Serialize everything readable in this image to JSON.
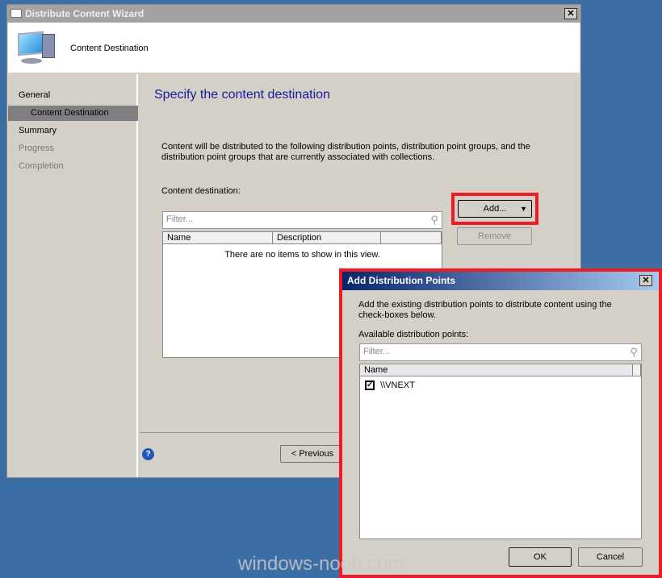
{
  "wizard": {
    "title": "Distribute Content Wizard",
    "header": "Content Destination",
    "nav": [
      {
        "label": "General",
        "state": "normal"
      },
      {
        "label": "Content Destination",
        "state": "selected"
      },
      {
        "label": "Summary",
        "state": "normal"
      },
      {
        "label": "Progress",
        "state": "disabled"
      },
      {
        "label": "Completion",
        "state": "disabled"
      }
    ],
    "page_title": "Specify the content destination",
    "description": "Content will be distributed to the following distribution points, distribution point groups, and the distribution point groups that are currently associated with collections.",
    "destination_label": "Content destination:",
    "filter_placeholder": "Filter...",
    "columns": [
      "Name",
      "Description"
    ],
    "empty_text": "There are no items to show in this view.",
    "add_label": "Add...",
    "remove_label": "Remove",
    "previous_label": "< Previous"
  },
  "dialog": {
    "title": "Add Distribution Points",
    "description": "Add the existing distribution points to distribute content using the check-boxes below.",
    "available_label": "Available distribution points:",
    "filter_placeholder": "Filter...",
    "column": "Name",
    "items": [
      {
        "name": "\\\\VNEXT",
        "checked": true
      }
    ],
    "ok_label": "OK",
    "cancel_label": "Cancel"
  },
  "watermark": "windows-noob.com",
  "colors": {
    "highlight": "#ed1c24",
    "title_blue": "#1a1a9c"
  }
}
